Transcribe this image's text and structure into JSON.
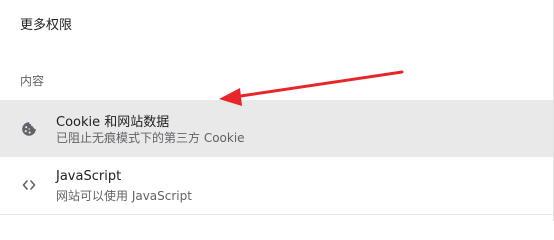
{
  "header": {
    "more_permissions_label": "更多权限"
  },
  "content_section": {
    "title": "内容",
    "items": [
      {
        "label": "Cookie 和网站数据",
        "sublabel": "已阻止无痕模式下的第三方 Cookie",
        "icon": "cookie-icon"
      },
      {
        "label": "JavaScript",
        "sublabel": "网站可以使用 JavaScript",
        "icon": "code-icon"
      }
    ]
  },
  "annotation": {
    "arrow_color": "#e8262a"
  },
  "colors": {
    "highlight_row": "#e9e9e9",
    "primary_text": "#202124",
    "secondary_text": "#5f6368"
  }
}
